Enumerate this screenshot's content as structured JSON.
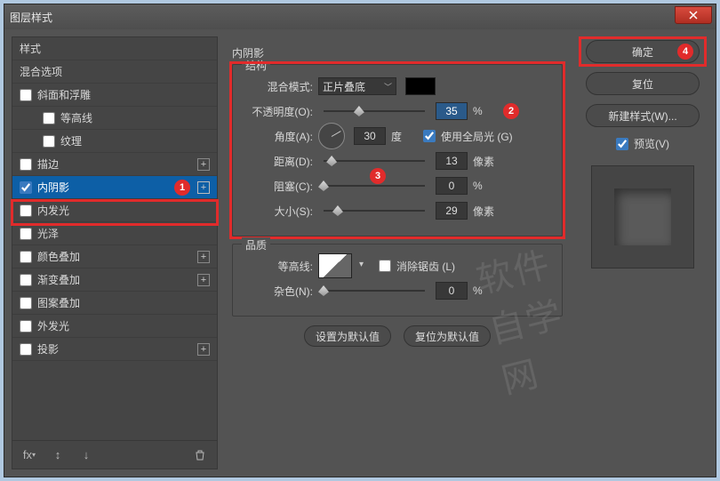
{
  "titlebar": {
    "title": "图层样式"
  },
  "styles": {
    "header": "样式",
    "blend": "混合选项",
    "bevel": "斜面和浮雕",
    "contour": "等高线",
    "texture": "纹理",
    "stroke": "描边",
    "innerShadow": "内阴影",
    "innerGlow": "内发光",
    "satin": "光泽",
    "colorOverlay": "颜色叠加",
    "gradientOverlay": "渐变叠加",
    "patternOverlay": "图案叠加",
    "outerGlow": "外发光",
    "dropShadow": "投影"
  },
  "main": {
    "title": "内阴影",
    "group1": "结构",
    "group2": "品质",
    "blendMode": {
      "label": "混合模式:",
      "value": "正片叠底"
    },
    "opacity": {
      "label": "不透明度(O):",
      "value": "35",
      "unit": "%"
    },
    "angle": {
      "label": "角度(A):",
      "value": "30",
      "unit": "度",
      "globalLabel": "使用全局光 (G)"
    },
    "distance": {
      "label": "距离(D):",
      "value": "13",
      "unit": "像素"
    },
    "choke": {
      "label": "阻塞(C):",
      "value": "0",
      "unit": "%"
    },
    "size": {
      "label": "大小(S):",
      "value": "29",
      "unit": "像素"
    },
    "qContour": {
      "label": "等高线:"
    },
    "antialias": "消除锯齿 (L)",
    "noise": {
      "label": "杂色(N):",
      "value": "0",
      "unit": "%"
    },
    "btnDefault": "设置为默认值",
    "btnReset": "复位为默认值"
  },
  "side": {
    "ok": "确定",
    "cancel": "复位",
    "newStyle": "新建样式(W)...",
    "preview": "预览(V)"
  },
  "badges": {
    "b1": "1",
    "b2": "2",
    "b3": "3",
    "b4": "4"
  }
}
